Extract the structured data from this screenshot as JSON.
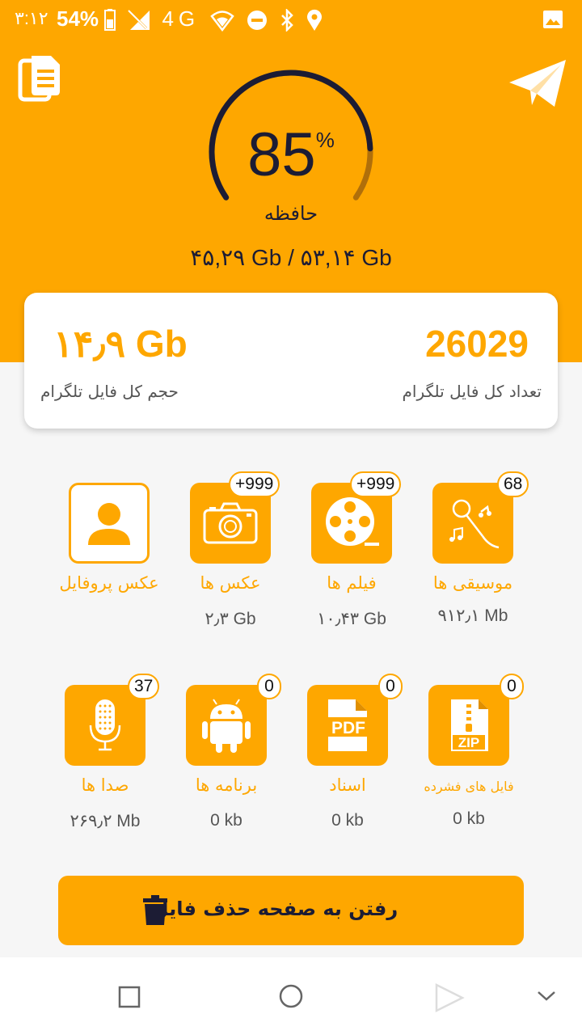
{
  "status_bar": {
    "time": "۳:۱۲",
    "battery": "54%",
    "network": "4G",
    "icons": [
      "battery-icon",
      "no-sim-icon",
      "wifi-icon",
      "dnd-icon",
      "bluetooth-icon",
      "location-icon",
      "gallery-icon"
    ]
  },
  "memory": {
    "percent": "85",
    "percent_symbol": "%",
    "percent_value": 85,
    "label": "حافظه",
    "usage": "۴۵,۲۹ Gb / ۵۳,۱۴ Gb"
  },
  "summary": {
    "total_size_value": "۱۴٫۹ Gb",
    "total_size_label": "حجم کل فایل تلگرام",
    "total_count_value": "26029",
    "total_count_label": "تعداد کل فایل تلگرام"
  },
  "categories": [
    {
      "name": "موسیقی ها",
      "size": "۹۱۲٫۱ Mb",
      "badge": "68",
      "icon": "music-icon"
    },
    {
      "name": "فیلم ها",
      "size": "۱۰٫۴۳ Gb",
      "badge": "+999",
      "icon": "film-reel-icon"
    },
    {
      "name": "عکس ها",
      "size": "۲٫۳ Gb",
      "badge": "+999",
      "icon": "camera-icon"
    },
    {
      "name": "عکس پروفایل",
      "size": "",
      "badge": "",
      "icon": "profile-icon"
    },
    {
      "name": "فایل های فشرده",
      "size": "0 kb",
      "badge": "0",
      "icon": "zip-file-icon"
    },
    {
      "name": "اسناد",
      "size": "0 kb",
      "badge": "0",
      "icon": "pdf-file-icon"
    },
    {
      "name": "برنامه ها",
      "size": "0 kb",
      "badge": "0",
      "icon": "android-icon"
    },
    {
      "name": "صدا ها",
      "size": "۲۶۹٫۲ Mb",
      "badge": "37",
      "icon": "microphone-icon"
    }
  ],
  "delete_button": {
    "label": "رفتن به صفحه حذف فایل",
    "icon": "trash-icon"
  },
  "nav_bar": {
    "icons": [
      "recents-icon",
      "home-icon",
      "back-icon",
      "collapse-icon"
    ]
  },
  "colors": {
    "accent": "#fea700",
    "dark": "#1c1c34",
    "background": "#f6f6f6"
  }
}
